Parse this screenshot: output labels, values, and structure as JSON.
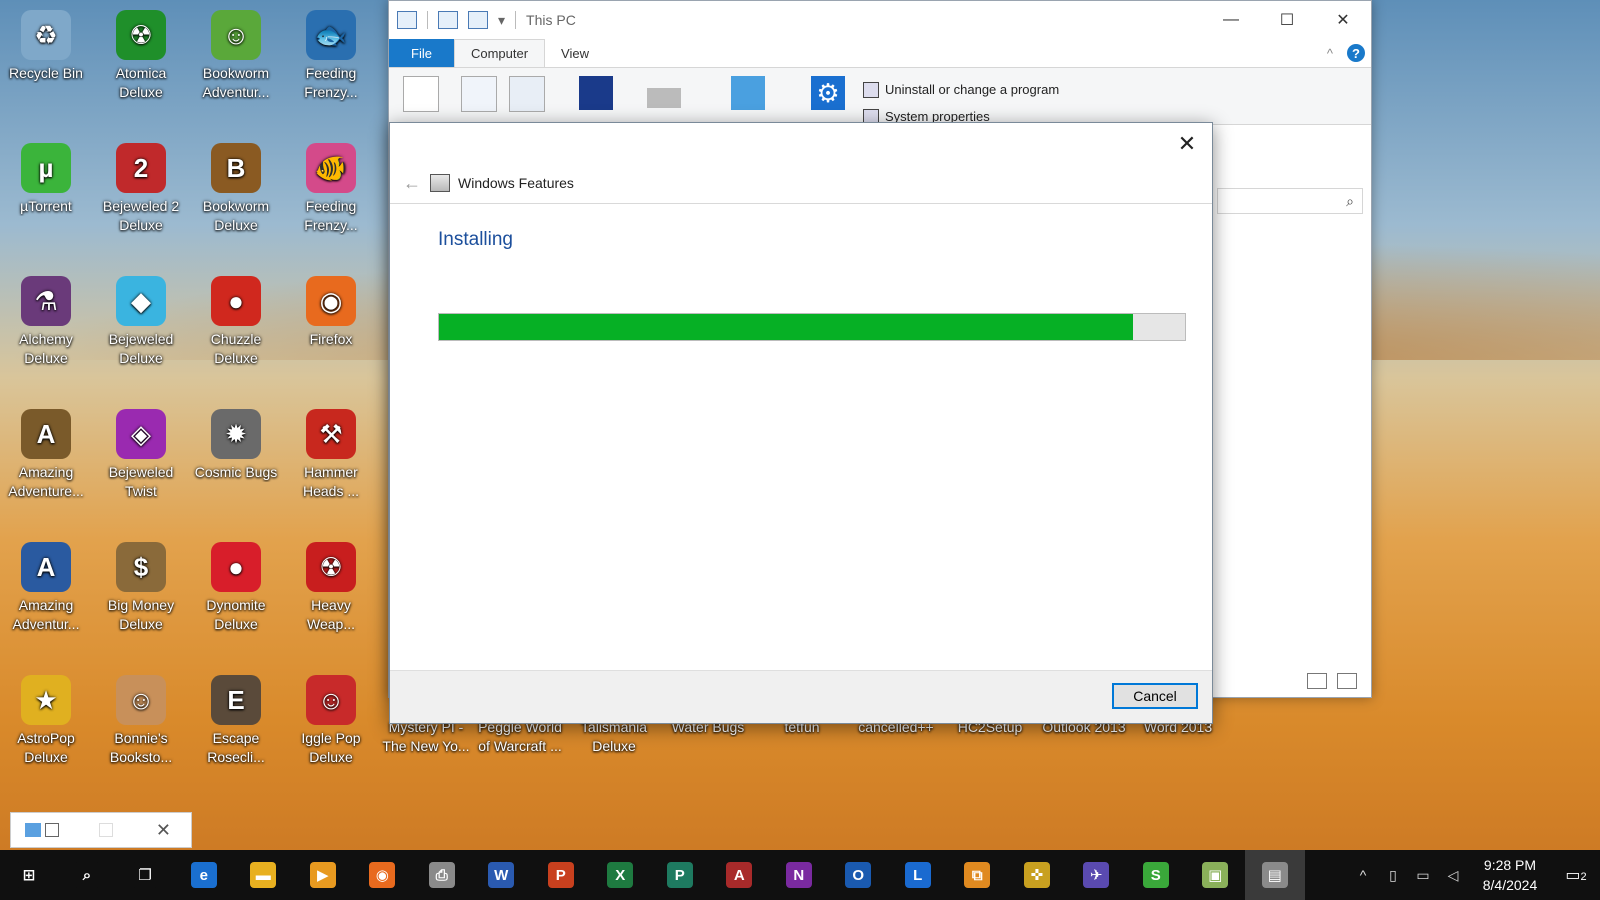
{
  "desktop": {
    "icons": [
      {
        "label": "Recycle Bin",
        "icon": "recycle-bin-icon",
        "color": "#7fa8c9",
        "glyph": "♻"
      },
      {
        "label": "Atomica Deluxe",
        "icon": "atomica-icon",
        "color": "#1f8f2a",
        "glyph": "☢"
      },
      {
        "label": "Bookworm Adventur...",
        "icon": "bookworm-adventures-icon",
        "color": "#5aa83a",
        "glyph": "☺"
      },
      {
        "label": "Feeding Frenzy...",
        "icon": "feeding-frenzy-icon",
        "color": "#2a6fb0",
        "glyph": "🐟"
      },
      {
        "label": "µTorrent",
        "icon": "utorrent-icon",
        "color": "#3bb43b",
        "glyph": "µ"
      },
      {
        "label": "Bejeweled 2 Deluxe",
        "icon": "bejeweled-2-icon",
        "color": "#c0292b",
        "glyph": "2"
      },
      {
        "label": "Bookworm Deluxe",
        "icon": "bookworm-deluxe-icon",
        "color": "#8a5a22",
        "glyph": "B"
      },
      {
        "label": "Feeding Frenzy...",
        "icon": "feeding-frenzy-2-icon",
        "color": "#d44a8a",
        "glyph": "🐠"
      },
      {
        "label": "Alchemy Deluxe",
        "icon": "alchemy-icon",
        "color": "#6a3a7a",
        "glyph": "⚗"
      },
      {
        "label": "Bejeweled Deluxe",
        "icon": "bejeweled-icon",
        "color": "#3ab4e0",
        "glyph": "◆"
      },
      {
        "label": "Chuzzle Deluxe",
        "icon": "chuzzle-icon",
        "color": "#d0281e",
        "glyph": "●"
      },
      {
        "label": "Firefox",
        "icon": "firefox-icon",
        "color": "#e86a1e",
        "glyph": "◉"
      },
      {
        "label": "Amazing Adventure...",
        "icon": "amazing-adventures-icon",
        "color": "#7a5a2a",
        "glyph": "A"
      },
      {
        "label": "Bejeweled Twist",
        "icon": "bejeweled-twist-icon",
        "color": "#9a2ab0",
        "glyph": "◈"
      },
      {
        "label": "Cosmic Bugs",
        "icon": "cosmic-bugs-icon",
        "color": "#6a6a6a",
        "glyph": "✹"
      },
      {
        "label": "Hammer Heads ...",
        "icon": "hammer-heads-icon",
        "color": "#c8281e",
        "glyph": "⚒"
      },
      {
        "label": "Amazing Adventur...",
        "icon": "amazing-adventures-2-icon",
        "color": "#2a5aa0",
        "glyph": "A"
      },
      {
        "label": "Big Money Deluxe",
        "icon": "big-money-icon",
        "color": "#8a6a3a",
        "glyph": "$"
      },
      {
        "label": "Dynomite Deluxe",
        "icon": "dynomite-icon",
        "color": "#d81e2a",
        "glyph": "●"
      },
      {
        "label": "Heavy Weap...",
        "icon": "heavy-weapon-icon",
        "color": "#c81e1e",
        "glyph": "☢"
      },
      {
        "label": "AstroPop Deluxe",
        "icon": "astropop-icon",
        "color": "#e0b020",
        "glyph": "★"
      },
      {
        "label": "Bonnie's Booksto...",
        "icon": "bonnies-bookstore-icon",
        "color": "#c8905a",
        "glyph": "☺"
      },
      {
        "label": "Escape Rosecli...",
        "icon": "escape-rosecliff-icon",
        "color": "#5a4a3a",
        "glyph": "E"
      },
      {
        "label": "Iggle Pop Deluxe",
        "icon": "iggle-pop-icon",
        "color": "#c82a2a",
        "glyph": "☺"
      }
    ],
    "bottom_row": [
      {
        "label": "Mystery PI - The New Yo...",
        "icon": "mystery-pi-icon"
      },
      {
        "label": "Peggle World of Warcraft ...",
        "icon": "peggle-icon"
      },
      {
        "label": "Talismania Deluxe",
        "icon": "talismania-icon"
      },
      {
        "label": "Water Bugs",
        "icon": "water-bugs-icon"
      },
      {
        "label": "tetfun",
        "icon": "tetfun-icon"
      },
      {
        "label": "cancelled++",
        "icon": "cancelled-icon"
      },
      {
        "label": "HC2Setup",
        "icon": "hc2setup-icon"
      },
      {
        "label": "Outlook 2013",
        "icon": "outlook-2013-icon"
      },
      {
        "label": "Word 2013",
        "icon": "word-2013-icon"
      }
    ]
  },
  "explorer": {
    "title": "This PC",
    "tabs": {
      "file": "File",
      "computer": "Computer",
      "view": "View"
    },
    "ribbon": {
      "uninstall_label": "Uninstall or change a program",
      "system_properties_label": "System properties"
    },
    "window_buttons": {
      "minimize": "—",
      "maximize": "☐",
      "close": "✕"
    },
    "help_glyph": "?",
    "collapse_glyph": "^",
    "search_glyph": "⌕"
  },
  "dialog": {
    "title": "Windows Features",
    "heading": "Installing",
    "progress_percent": 93,
    "cancel_label": "Cancel",
    "close_glyph": "✕",
    "back_glyph": "←"
  },
  "taskbar": {
    "apps": [
      {
        "icon": "start-icon",
        "glyph": "⊞",
        "color": "#101010"
      },
      {
        "icon": "search-icon",
        "glyph": "⌕",
        "color": "#101010"
      },
      {
        "icon": "task-view-icon",
        "glyph": "❐",
        "color": "#101010"
      },
      {
        "icon": "edge-icon",
        "glyph": "e",
        "color": "#1a6fd0"
      },
      {
        "icon": "file-explorer-icon",
        "glyph": "▬",
        "color": "#e8b020"
      },
      {
        "icon": "media-player-icon",
        "glyph": "▶",
        "color": "#e89a20"
      },
      {
        "icon": "firefox-taskbar-icon",
        "glyph": "◉",
        "color": "#e86a1e"
      },
      {
        "icon": "printer-icon",
        "glyph": "⎙",
        "color": "#8a8a8a"
      },
      {
        "icon": "word-icon",
        "glyph": "W",
        "color": "#2a5ab0"
      },
      {
        "icon": "powerpoint-icon",
        "glyph": "P",
        "color": "#c8401e"
      },
      {
        "icon": "excel-icon",
        "glyph": "X",
        "color": "#1e7a40"
      },
      {
        "icon": "publisher-icon",
        "glyph": "P",
        "color": "#1e7a60"
      },
      {
        "icon": "access-icon",
        "glyph": "A",
        "color": "#a82a2a"
      },
      {
        "icon": "onenote-icon",
        "glyph": "N",
        "color": "#7a2aa0"
      },
      {
        "icon": "outlook-icon",
        "glyph": "O",
        "color": "#1a5ab0"
      },
      {
        "icon": "lync-icon",
        "glyph": "L",
        "color": "#1a6ad0"
      },
      {
        "icon": "remote-desktop-icon",
        "glyph": "⧉",
        "color": "#e08a20"
      },
      {
        "icon": "network-tool-icon",
        "glyph": "✜",
        "color": "#c8a020"
      },
      {
        "icon": "bird-app-icon",
        "glyph": "✈",
        "color": "#5a4ab0"
      },
      {
        "icon": "s-app-icon",
        "glyph": "S",
        "color": "#3aa83a"
      },
      {
        "icon": "installer-icon",
        "glyph": "▣",
        "color": "#8ab05a"
      },
      {
        "icon": "windows-features-taskbar-icon",
        "glyph": "▤",
        "color": "#8a8a8a"
      }
    ],
    "time": "9:28 PM",
    "date": "8/4/2024",
    "notification_count": "2"
  }
}
